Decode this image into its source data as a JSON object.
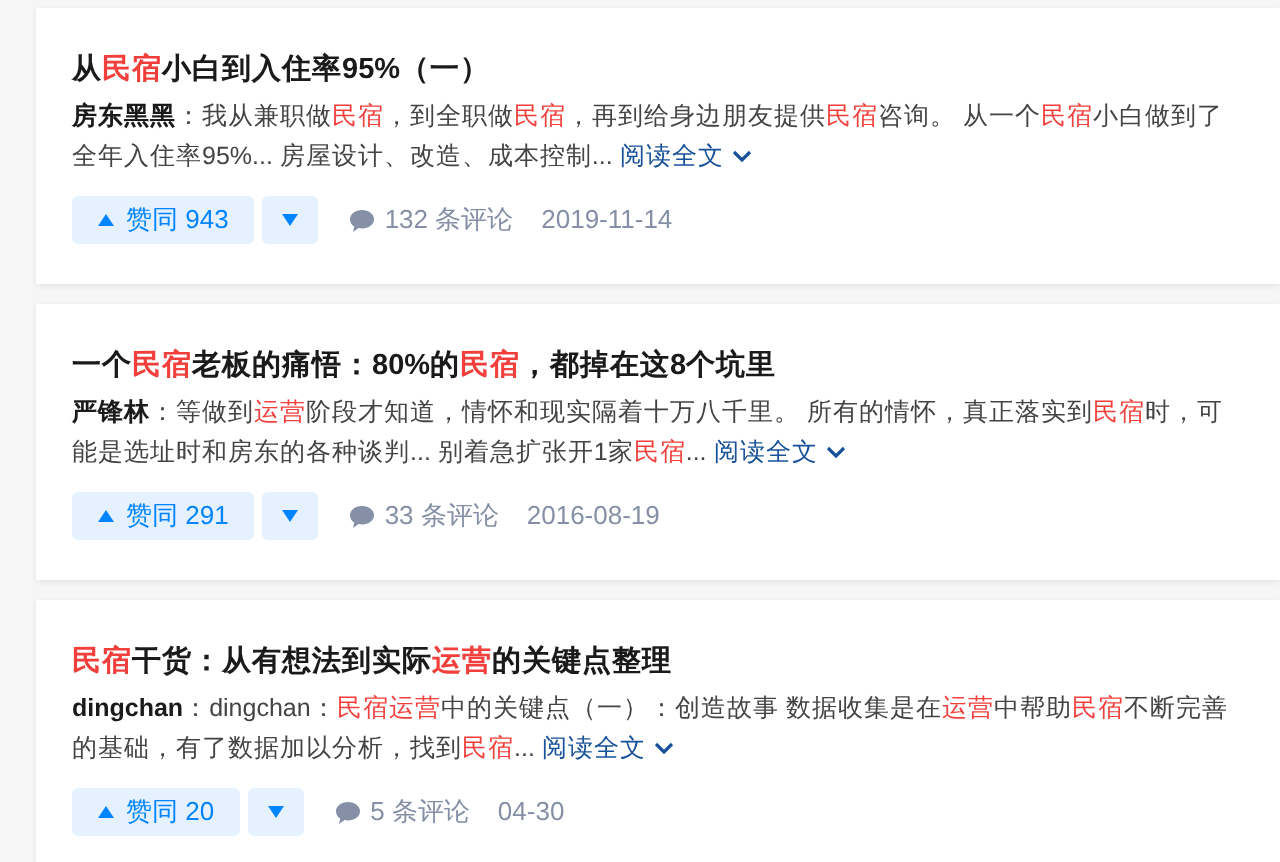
{
  "answers": [
    {
      "title": [
        {
          "text": "从",
          "highlight": false
        },
        {
          "text": "民宿",
          "highlight": true
        },
        {
          "text": "小白到入住率95%（一）",
          "highlight": false
        }
      ],
      "author": "房东黑黑",
      "snippet": [
        {
          "text": "：我从兼职做",
          "highlight": false
        },
        {
          "text": "民宿",
          "highlight": true
        },
        {
          "text": "，到全职做",
          "highlight": false
        },
        {
          "text": "民宿",
          "highlight": true
        },
        {
          "text": "，再到给身边朋友提供",
          "highlight": false
        },
        {
          "text": "民宿",
          "highlight": true
        },
        {
          "text": "咨询。 从一个",
          "highlight": false
        },
        {
          "text": "民宿",
          "highlight": true
        },
        {
          "text": "小白做到了全年入住率95%... 房屋设计、改造、成本控制...",
          "highlight": false
        }
      ],
      "read_more": "阅读全文",
      "upvote": "赞同 943",
      "comments": "132 条评论",
      "date": "2019-11-14"
    },
    {
      "title": [
        {
          "text": "一个",
          "highlight": false
        },
        {
          "text": "民宿",
          "highlight": true
        },
        {
          "text": "老板的痛悟：80%的",
          "highlight": false
        },
        {
          "text": "民宿",
          "highlight": true
        },
        {
          "text": "，都掉在这8个坑里",
          "highlight": false
        }
      ],
      "author": "严锋林",
      "snippet": [
        {
          "text": "：等做到",
          "highlight": false
        },
        {
          "text": "运营",
          "highlight": true
        },
        {
          "text": "阶段才知道，情怀和现实隔着十万八千里。 所有的情怀，真正落实到",
          "highlight": false
        },
        {
          "text": "民宿",
          "highlight": true
        },
        {
          "text": "时，可能是选址时和房东的各种谈判... 别着急扩张开1家",
          "highlight": false
        },
        {
          "text": "民宿",
          "highlight": true
        },
        {
          "text": "...",
          "highlight": false
        }
      ],
      "read_more": "阅读全文",
      "upvote": "赞同 291",
      "comments": "33 条评论",
      "date": "2016-08-19"
    },
    {
      "title": [
        {
          "text": "民宿",
          "highlight": true
        },
        {
          "text": "干货：从有想法到实际",
          "highlight": false
        },
        {
          "text": "运营",
          "highlight": true
        },
        {
          "text": "的关键点整理",
          "highlight": false
        }
      ],
      "author": "dingchan",
      "snippet": [
        {
          "text": "：dingchan：",
          "highlight": false
        },
        {
          "text": "民宿运营",
          "highlight": true
        },
        {
          "text": "中的关键点（一）：创造故事 数据收集是在",
          "highlight": false
        },
        {
          "text": "运营",
          "highlight": true
        },
        {
          "text": "中帮助",
          "highlight": false
        },
        {
          "text": "民宿",
          "highlight": true
        },
        {
          "text": "不断完善的基础，有了数据加以分析，找到",
          "highlight": false
        },
        {
          "text": "民宿",
          "highlight": true
        },
        {
          "text": "...",
          "highlight": false
        }
      ],
      "read_more": "阅读全文",
      "upvote": "赞同 20",
      "comments": "5 条评论",
      "date": "04-30"
    }
  ]
}
